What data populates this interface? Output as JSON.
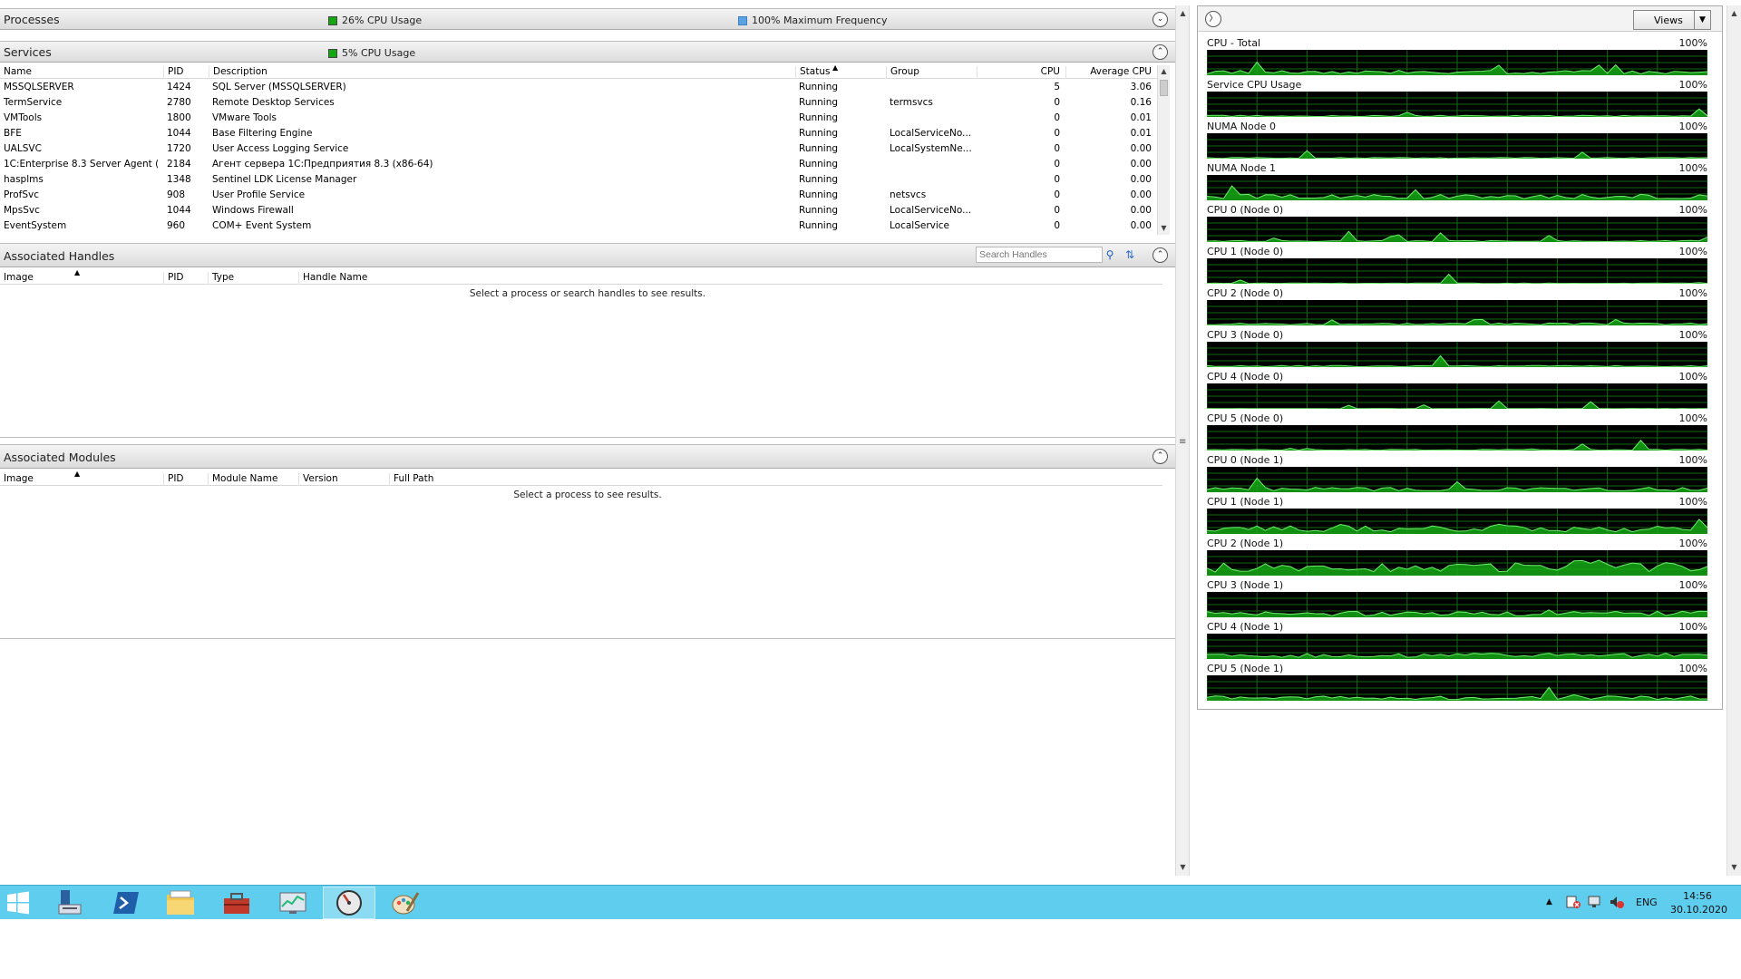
{
  "processes": {
    "title": "Processes",
    "cpu_usage": "26% CPU Usage",
    "max_frequency": "100% Maximum Frequency",
    "colors": {
      "cpu": "#13a810",
      "freq": "#5aa3e0"
    }
  },
  "services": {
    "title": "Services",
    "cpu_usage": "5% CPU Usage",
    "columns": [
      "Name",
      "PID",
      "Description",
      "Status",
      "Group",
      "CPU",
      "Average CPU"
    ],
    "sort_column": "Status",
    "rows": [
      {
        "name": "MSSQLSERVER",
        "pid": "1424",
        "desc": "SQL Server (MSSQLSERVER)",
        "status": "Running",
        "group": "",
        "cpu": "5",
        "avg": "3.06"
      },
      {
        "name": "TermService",
        "pid": "2780",
        "desc": "Remote Desktop Services",
        "status": "Running",
        "group": "termsvcs",
        "cpu": "0",
        "avg": "0.16"
      },
      {
        "name": "VMTools",
        "pid": "1800",
        "desc": "VMware Tools",
        "status": "Running",
        "group": "",
        "cpu": "0",
        "avg": "0.01"
      },
      {
        "name": "BFE",
        "pid": "1044",
        "desc": "Base Filtering Engine",
        "status": "Running",
        "group": "LocalServiceNo...",
        "cpu": "0",
        "avg": "0.01"
      },
      {
        "name": "UALSVC",
        "pid": "1720",
        "desc": "User Access Logging Service",
        "status": "Running",
        "group": "LocalSystemNe...",
        "cpu": "0",
        "avg": "0.00"
      },
      {
        "name": "1C:Enterprise 8.3 Server Agent (...",
        "pid": "2184",
        "desc": "Агент сервера 1С:Предприятия 8.3 (x86-64)",
        "status": "Running",
        "group": "",
        "cpu": "0",
        "avg": "0.00"
      },
      {
        "name": "hasplms",
        "pid": "1348",
        "desc": "Sentinel LDK License Manager",
        "status": "Running",
        "group": "",
        "cpu": "0",
        "avg": "0.00"
      },
      {
        "name": "ProfSvc",
        "pid": "908",
        "desc": "User Profile Service",
        "status": "Running",
        "group": "netsvcs",
        "cpu": "0",
        "avg": "0.00"
      },
      {
        "name": "MpsSvc",
        "pid": "1044",
        "desc": "Windows Firewall",
        "status": "Running",
        "group": "LocalServiceNo...",
        "cpu": "0",
        "avg": "0.00"
      },
      {
        "name": "EventSystem",
        "pid": "960",
        "desc": "COM+ Event System",
        "status": "Running",
        "group": "LocalService",
        "cpu": "0",
        "avg": "0.00"
      }
    ]
  },
  "handles": {
    "title": "Associated Handles",
    "search_placeholder": "Search Handles",
    "columns": [
      "Image",
      "PID",
      "Type",
      "Handle Name"
    ],
    "empty": "Select a process or search handles to see results."
  },
  "modules": {
    "title": "Associated Modules",
    "columns": [
      "Image",
      "PID",
      "Module Name",
      "Version",
      "Full Path"
    ],
    "empty": "Select a process to see results."
  },
  "views_button": "Views",
  "graphs": [
    {
      "name": "CPU - Total",
      "pct": "100%",
      "level": 0.12
    },
    {
      "name": "Service CPU Usage",
      "pct": "100%",
      "level": 0.04
    },
    {
      "name": "NUMA Node 0",
      "pct": "100%",
      "level": 0.03
    },
    {
      "name": "NUMA Node 1",
      "pct": "100%",
      "level": 0.15
    },
    {
      "name": "CPU 0 (Node 0)",
      "pct": "100%",
      "level": 0.04
    },
    {
      "name": "CPU 1 (Node 0)",
      "pct": "100%",
      "level": 0.02
    },
    {
      "name": "CPU 2 (Node 0)",
      "pct": "100%",
      "level": 0.06
    },
    {
      "name": "CPU 3 (Node 0)",
      "pct": "100%",
      "level": 0.04
    },
    {
      "name": "CPU 4 (Node 0)",
      "pct": "100%",
      "level": 0.01
    },
    {
      "name": "CPU 5 (Node 0)",
      "pct": "100%",
      "level": 0.03
    },
    {
      "name": "CPU 0 (Node 1)",
      "pct": "100%",
      "level": 0.12
    },
    {
      "name": "CPU 1 (Node 1)",
      "pct": "100%",
      "level": 0.2
    },
    {
      "name": "CPU 2 (Node 1)",
      "pct": "100%",
      "level": 0.32
    },
    {
      "name": "CPU 3 (Node 1)",
      "pct": "100%",
      "level": 0.15
    },
    {
      "name": "CPU 4 (Node 1)",
      "pct": "100%",
      "level": 0.14
    },
    {
      "name": "CPU 5 (Node 1)",
      "pct": "100%",
      "level": 0.12
    }
  ],
  "graph_colors": {
    "bg": "#000000",
    "grid": "#0f6b0f",
    "fill": "#15a815",
    "line": "#6cf06c"
  },
  "taskbar": {
    "icons": [
      "windows-start-icon",
      "server-manager-icon",
      "powershell-icon",
      "file-explorer-icon",
      "toolbox-icon",
      "performance-monitor-icon",
      "resource-monitor-icon",
      "paint-icon"
    ],
    "language": "ENG",
    "time": "14:56",
    "date": "30.10.2020",
    "bg": "#5fcdee"
  }
}
